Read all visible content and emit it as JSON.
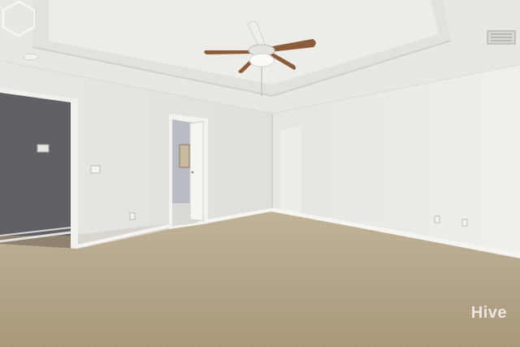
{
  "scene": {
    "description_tag": "empty-bedroom-photo",
    "colors": {
      "ceiling": "#eceae6",
      "tray_ceiling": "#e4e2de",
      "wall_left": "#e6e4e0",
      "wall_right": "#ebe9e5",
      "carpet": "#b5a58b",
      "carpet_shadow": "#a39276",
      "doorway_dark": "#5e6064",
      "baseboard": "#f4f3f0",
      "fan_blade": "#8a5a3b",
      "fan_body": "#e8e6e2"
    }
  },
  "watermark": {
    "text": "Hive"
  }
}
